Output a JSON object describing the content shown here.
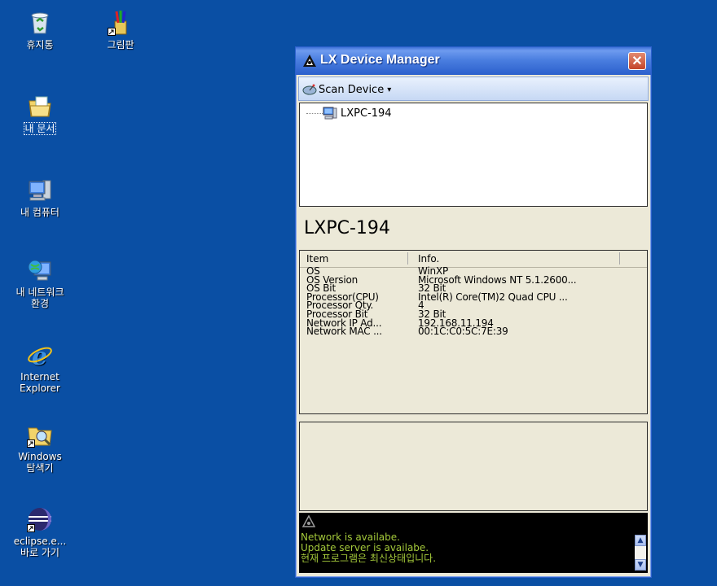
{
  "desktop": {
    "icons": [
      {
        "label": "휴지통",
        "icon": "recycle-bin-icon"
      },
      {
        "label": "그림판",
        "icon": "paint-icon"
      },
      {
        "label": "내 문서",
        "icon": "my-documents-icon"
      },
      {
        "label": "내 컴퓨터",
        "icon": "my-computer-icon"
      },
      {
        "label": "내 네트워크\n환경",
        "icon": "network-places-icon"
      },
      {
        "label": "Internet\nExplorer",
        "icon": "internet-explorer-icon"
      },
      {
        "label": "Windows\n탐색기",
        "icon": "windows-explorer-icon"
      },
      {
        "label": "eclipse.e...\n바로 가기",
        "icon": "eclipse-icon"
      }
    ]
  },
  "window": {
    "title": "LX Device Manager",
    "close_label": "✕",
    "toolbar": {
      "scan_label": "Scan Device",
      "scan_caret": "▾"
    },
    "tree": {
      "node_label": "LXPC-194"
    },
    "device_name": "LXPC-194",
    "info": {
      "headers": [
        "Item",
        "Info."
      ],
      "rows": [
        {
          "item": "OS",
          "info": "WinXP"
        },
        {
          "item": "OS Version",
          "info": "Microsoft Windows NT 5.1.2600..."
        },
        {
          "item": "OS Bit",
          "info": "32 Bit"
        },
        {
          "item": "Processor(CPU)",
          "info": "Intel(R) Core(TM)2 Quad CPU ..."
        },
        {
          "item": "Processor Qty.",
          "info": "4"
        },
        {
          "item": "Processor Bit",
          "info": "32 Bit"
        },
        {
          "item": "Network IP Ad...",
          "info": "192.168.11.194"
        },
        {
          "item": "Network MAC ...",
          "info": "00:1C:C0:5C:7E:39"
        }
      ]
    },
    "log": [
      "Network is availabe.",
      "Update server is availabe.",
      "현재 프로그램은 최신상태입니다."
    ],
    "scroll": {
      "up": "▲",
      "down": "▼"
    }
  },
  "colors": {
    "desktop": "#0a4fa4",
    "log_text": "#a3c83a",
    "titlebar": "#2b5fcc"
  }
}
